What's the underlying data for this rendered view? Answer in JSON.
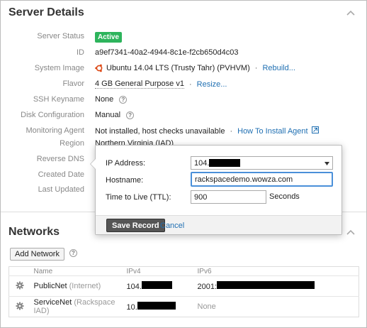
{
  "server_details": {
    "title": "Server Details",
    "rows": {
      "status": {
        "label": "Server Status",
        "value": "Active"
      },
      "id": {
        "label": "ID",
        "value": "a9ef7341-40a2-4944-8c1e-f2cb650d4c03"
      },
      "image": {
        "label": "System Image",
        "value": "Ubuntu 14.04 LTS (Trusty Tahr) (PVHVM)",
        "action": "Rebuild..."
      },
      "flavor": {
        "label": "Flavor",
        "value": "4 GB General Purpose v1",
        "action": "Resize..."
      },
      "ssh": {
        "label": "SSH Keyname",
        "value": "None"
      },
      "disk": {
        "label": "Disk Configuration",
        "value": "Manual"
      },
      "monitoring": {
        "label": "Monitoring Agent",
        "value": "Not installed, host checks unavailable",
        "action": "How To Install Agent"
      },
      "region": {
        "label": "Region",
        "value": "Northern Virginia (IAD)"
      },
      "rdns": {
        "label": "Reverse DNS"
      },
      "created": {
        "label": "Created Date"
      },
      "updated": {
        "label": "Last Updated"
      }
    },
    "separator": "·",
    "help": "?"
  },
  "rdns_popover": {
    "ip_label": "IP Address:",
    "ip_value": "104.",
    "hostname_label": "Hostname:",
    "hostname_value": "rackspacedemo.wowza.com",
    "ttl_label": "Time to Live (TTL):",
    "ttl_value": "900",
    "ttl_unit": "Seconds",
    "save_label": "Save Record",
    "cancel_label": "Cancel"
  },
  "networks": {
    "title": "Networks",
    "add_label": "Add Network",
    "help": "?",
    "columns": [
      "Name",
      "IPv4",
      "IPv6"
    ],
    "rows": [
      {
        "name": "PublicNet",
        "qualifier": "(Internet)",
        "ipv4": "104.",
        "ipv6": "2001:"
      },
      {
        "name": "ServiceNet",
        "qualifier": "(Rackspace IAD)",
        "ipv4": "10.",
        "ipv6": "None"
      }
    ]
  },
  "colors": {
    "active": "#2db45c",
    "link": "#1f6fb2",
    "ubuntu": "#dd4814"
  }
}
